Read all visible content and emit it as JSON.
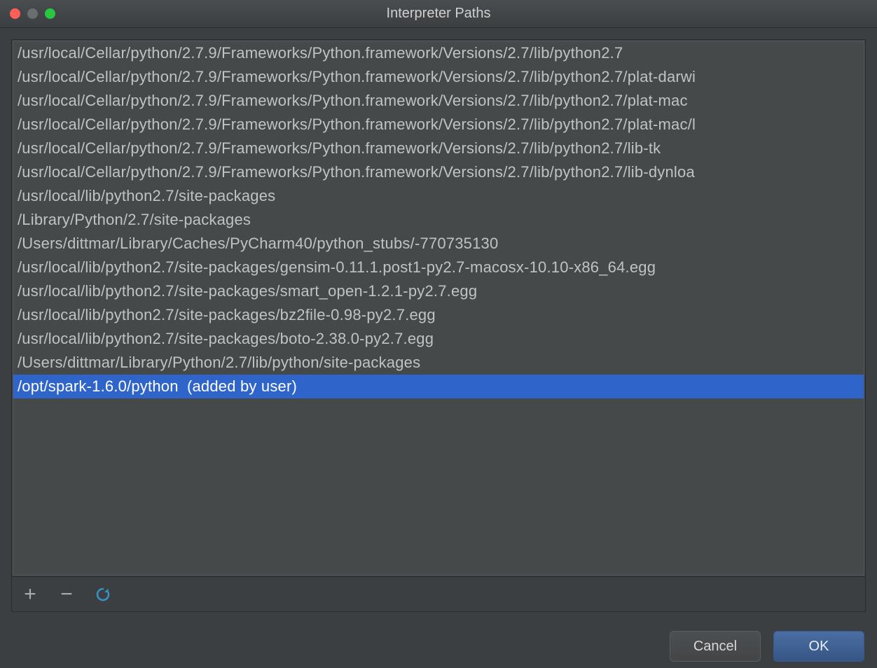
{
  "window": {
    "title": "Interpreter Paths"
  },
  "paths": [
    {
      "text": "/usr/local/Cellar/python/2.7.9/Frameworks/Python.framework/Versions/2.7/lib/python2.7",
      "suffix": "",
      "selected": false
    },
    {
      "text": "/usr/local/Cellar/python/2.7.9/Frameworks/Python.framework/Versions/2.7/lib/python2.7/plat-darwi",
      "suffix": "",
      "selected": false
    },
    {
      "text": "/usr/local/Cellar/python/2.7.9/Frameworks/Python.framework/Versions/2.7/lib/python2.7/plat-mac",
      "suffix": "",
      "selected": false
    },
    {
      "text": "/usr/local/Cellar/python/2.7.9/Frameworks/Python.framework/Versions/2.7/lib/python2.7/plat-mac/l",
      "suffix": "",
      "selected": false
    },
    {
      "text": "/usr/local/Cellar/python/2.7.9/Frameworks/Python.framework/Versions/2.7/lib/python2.7/lib-tk",
      "suffix": "",
      "selected": false
    },
    {
      "text": "/usr/local/Cellar/python/2.7.9/Frameworks/Python.framework/Versions/2.7/lib/python2.7/lib-dynloa",
      "suffix": "",
      "selected": false
    },
    {
      "text": "/usr/local/lib/python2.7/site-packages",
      "suffix": "",
      "selected": false
    },
    {
      "text": "/Library/Python/2.7/site-packages",
      "suffix": "",
      "selected": false
    },
    {
      "text": "/Users/dittmar/Library/Caches/PyCharm40/python_stubs/-770735130",
      "suffix": "",
      "selected": false
    },
    {
      "text": "/usr/local/lib/python2.7/site-packages/gensim-0.11.1.post1-py2.7-macosx-10.10-x86_64.egg",
      "suffix": "",
      "selected": false
    },
    {
      "text": "/usr/local/lib/python2.7/site-packages/smart_open-1.2.1-py2.7.egg",
      "suffix": "",
      "selected": false
    },
    {
      "text": "/usr/local/lib/python2.7/site-packages/bz2file-0.98-py2.7.egg",
      "suffix": "",
      "selected": false
    },
    {
      "text": "/usr/local/lib/python2.7/site-packages/boto-2.38.0-py2.7.egg",
      "suffix": "",
      "selected": false
    },
    {
      "text": "/Users/dittmar/Library/Python/2.7/lib/python/site-packages",
      "suffix": "",
      "selected": false
    },
    {
      "text": "/opt/spark-1.6.0/python",
      "suffix": " (added by user)",
      "selected": true
    }
  ],
  "buttons": {
    "cancel": "Cancel",
    "ok": "OK"
  },
  "toolbar": {
    "add_tip": "Add",
    "remove_tip": "Remove",
    "reload_tip": "Reload"
  }
}
